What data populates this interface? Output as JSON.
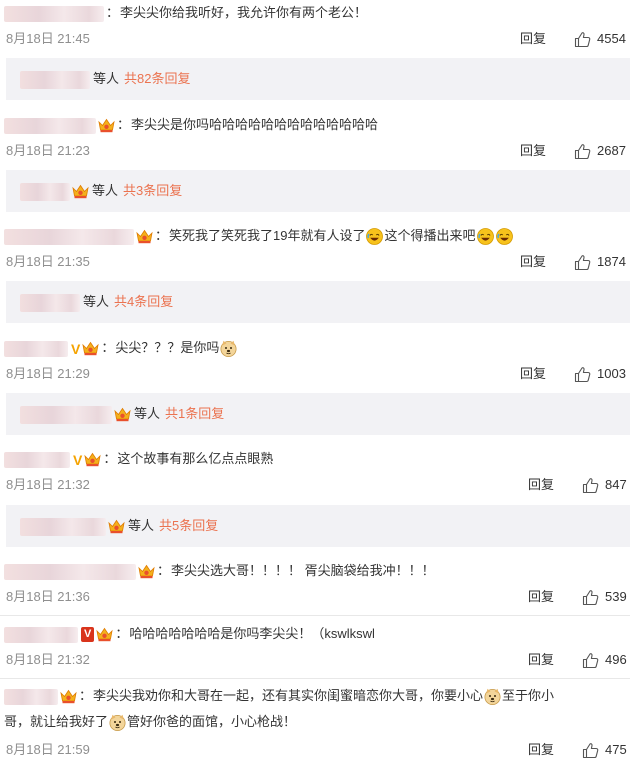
{
  "comments": [
    {
      "body_segments": [
        "李尖尖你给我听好，我允许你有两个老公！"
      ],
      "time": "8月18日 21:45",
      "reply_label": "回复",
      "likes": "4554",
      "replies_etc": "等人",
      "replies_count": "共82条回复"
    },
    {
      "body_segments": [
        "李尖尖是你吗哈哈哈哈哈哈哈哈哈哈哈哈哈"
      ],
      "time": "8月18日 21:23",
      "reply_label": "回复",
      "likes": "2687",
      "replies_etc": "等人",
      "replies_count": "共3条回复"
    },
    {
      "body_segments": [
        "笑死我了笑死我了19年就有人设了",
        "这个得播出来吧"
      ],
      "emojis": [
        "laughing-cry-emoji",
        "laughing-cry-emoji",
        "laughing-cry-emoji"
      ],
      "time": "8月18日 21:35",
      "reply_label": "回复",
      "likes": "1874",
      "replies_etc": "等人",
      "replies_count": "共4条回复"
    },
    {
      "body_segments": [
        "尖尖？？？是你吗"
      ],
      "emojis": [
        "doge-emoji"
      ],
      "time": "8月18日 21:29",
      "reply_label": "回复",
      "likes": "1003",
      "replies_etc": "等人",
      "replies_count": "共1条回复"
    },
    {
      "body_segments": [
        "这个故事有那么亿点点眼熟"
      ],
      "time": "8月18日 21:32",
      "reply_label": "回复",
      "likes": "847",
      "replies_etc": "等人",
      "replies_count": "共5条回复"
    },
    {
      "body_segments": [
        "李尖尖选大哥！！！！ 胥尖脑袋给我冲！！！"
      ],
      "time": "8月18日 21:36",
      "reply_label": "回复",
      "likes": "539"
    },
    {
      "body_segments": [
        "哈哈哈哈哈哈哈是你吗李尖尖！（kswlkswl"
      ],
      "time": "8月18日 21:32",
      "reply_label": "回复",
      "likes": "496"
    },
    {
      "line1_segments": [
        "李尖尖我劝你和大哥在一起，还有其实你闺蜜暗恋你大哥，你要小心",
        "至于你小"
      ],
      "line2_segments": [
        "哥，就让给我好了",
        "管好你爸的面馆，小心枪战！"
      ],
      "emojis": [
        "doge-emoji",
        "doge-emoji"
      ],
      "time": "8月18日 21:59",
      "reply_label": "回复",
      "likes": "475"
    }
  ],
  "icons": {
    "crown": "crown-badge-icon",
    "vip": "vip-v-icon",
    "thumb": "thumbs-up-icon"
  },
  "colors": {
    "reply_count": "#eb7350",
    "time": "#8f8f8f",
    "reply_box_bg": "#f2f2f5",
    "vip_orange": "#f5a300"
  }
}
